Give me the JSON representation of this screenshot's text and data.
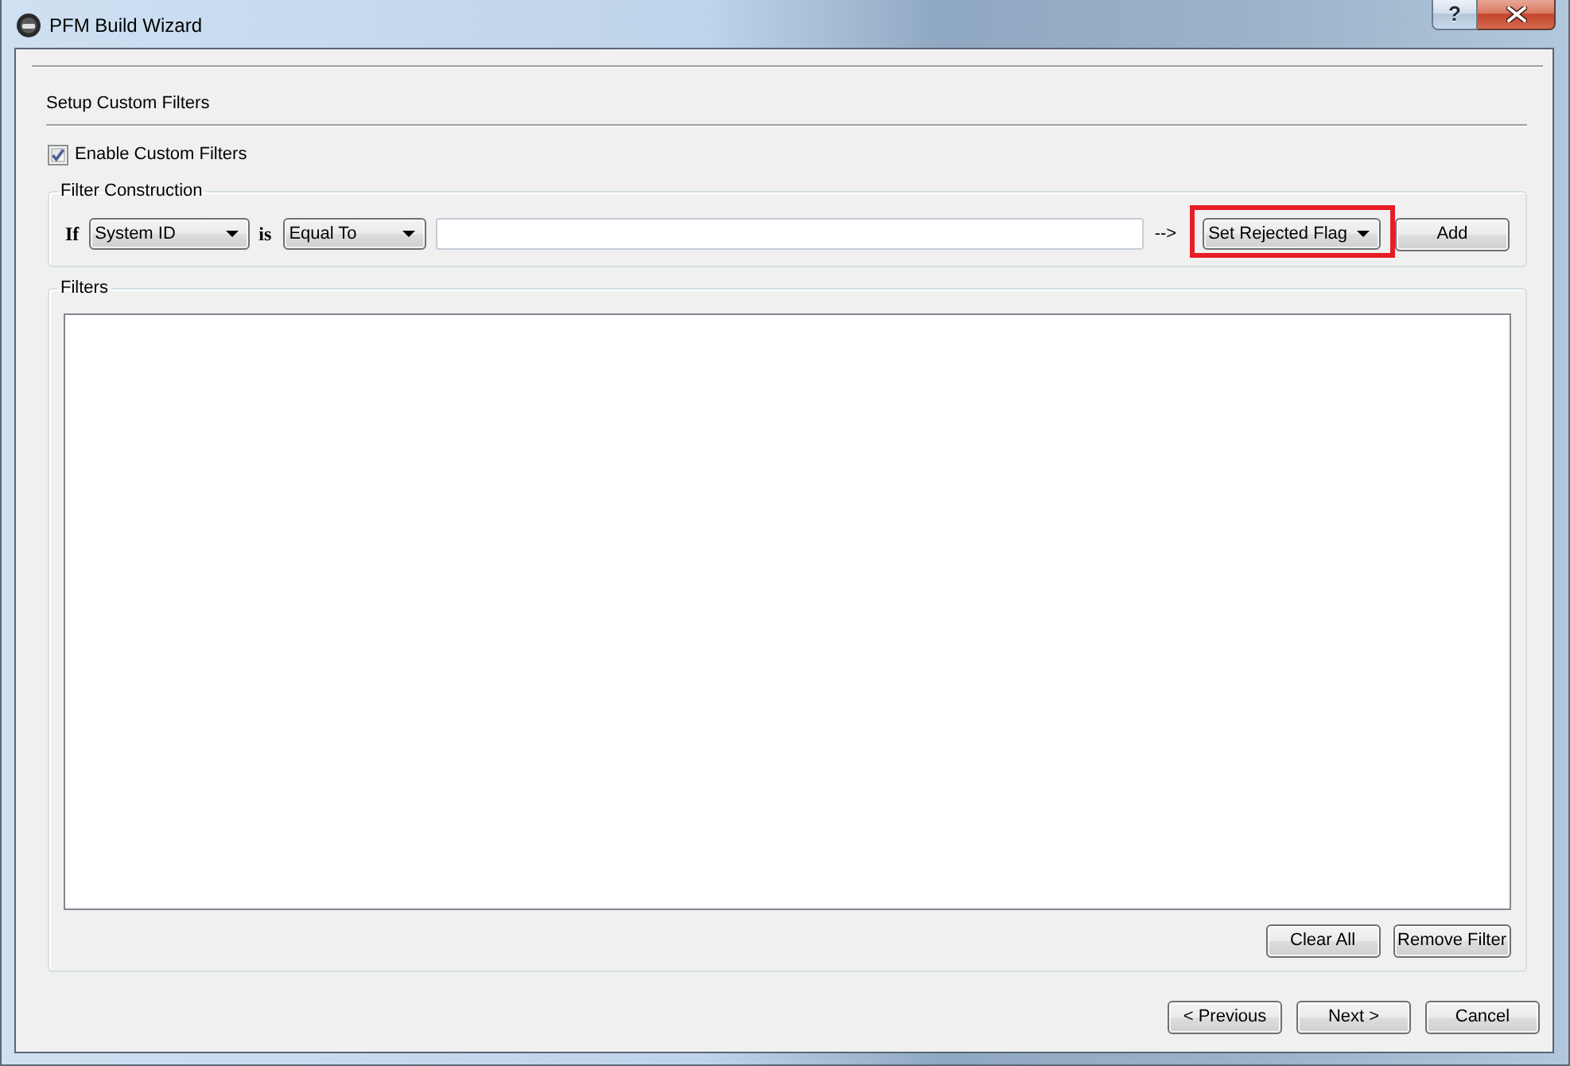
{
  "window": {
    "title": "PFM Build Wizard",
    "help_button": "?"
  },
  "page": {
    "heading": "Setup Custom Filters",
    "enable_custom_filters": {
      "label": "Enable Custom Filters",
      "checked": true
    }
  },
  "filter_construction": {
    "title": "Filter Construction",
    "if_label": "If",
    "field": "System ID",
    "is_label": "is",
    "operator": "Equal To",
    "arrow_label": "-->",
    "action": {
      "value": "Set Rejected Flag",
      "highlighted": true
    },
    "add_button": "Add"
  },
  "filters": {
    "title": "Filters",
    "buttons": [
      "Clear All",
      "Remove Filter"
    ]
  },
  "footer": {
    "buttons": [
      "< Previous",
      "Next >",
      "Cancel"
    ]
  }
}
